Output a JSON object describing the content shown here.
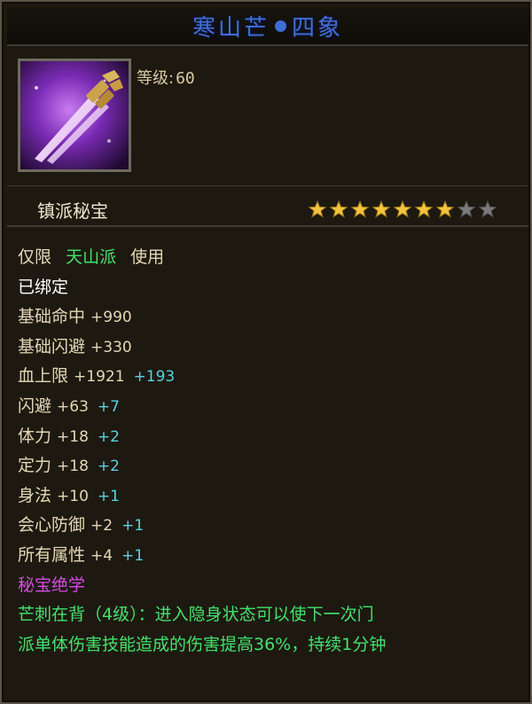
{
  "title": {
    "name": "寒山芒",
    "category": "四象"
  },
  "item": {
    "level_label": "等级:",
    "level_value": "60",
    "type_label": "镇派秘宝",
    "rating": {
      "filled": 7,
      "total": 9
    }
  },
  "colors": {
    "title_blue": "#3f6ed8",
    "gold_star": "#f3c43a",
    "green_text": "#3fe36c",
    "cyan_bonus": "#5ad1e0",
    "purple_text": "#d64be2"
  },
  "restriction": {
    "prefix": "仅限",
    "sect": "天山派",
    "suffix": "使用"
  },
  "bound": "已绑定",
  "stats": [
    {
      "name": "基础命中",
      "value": "+990"
    },
    {
      "name": "基础闪避",
      "value": "+330"
    },
    {
      "name": "血上限",
      "value": "+1921",
      "bonus": "+193"
    },
    {
      "name": "闪避",
      "value": "+63",
      "bonus": "+7"
    },
    {
      "name": "体力",
      "value": "+18",
      "bonus": "+2"
    },
    {
      "name": "定力",
      "value": "+18",
      "bonus": "+2"
    },
    {
      "name": "身法",
      "value": "+10",
      "bonus": "+1"
    },
    {
      "name": "会心防御",
      "value": "+2",
      "bonus": "+1"
    },
    {
      "name": "所有属性",
      "value": "+4",
      "bonus": "+1"
    }
  ],
  "skill": {
    "heading": "秘宝绝学",
    "line1": "芒刺在背（4级）：进入隐身状态可以使下一次门",
    "line2": "派单体伤害技能造成的伤害提高36%，持续1分钟"
  }
}
